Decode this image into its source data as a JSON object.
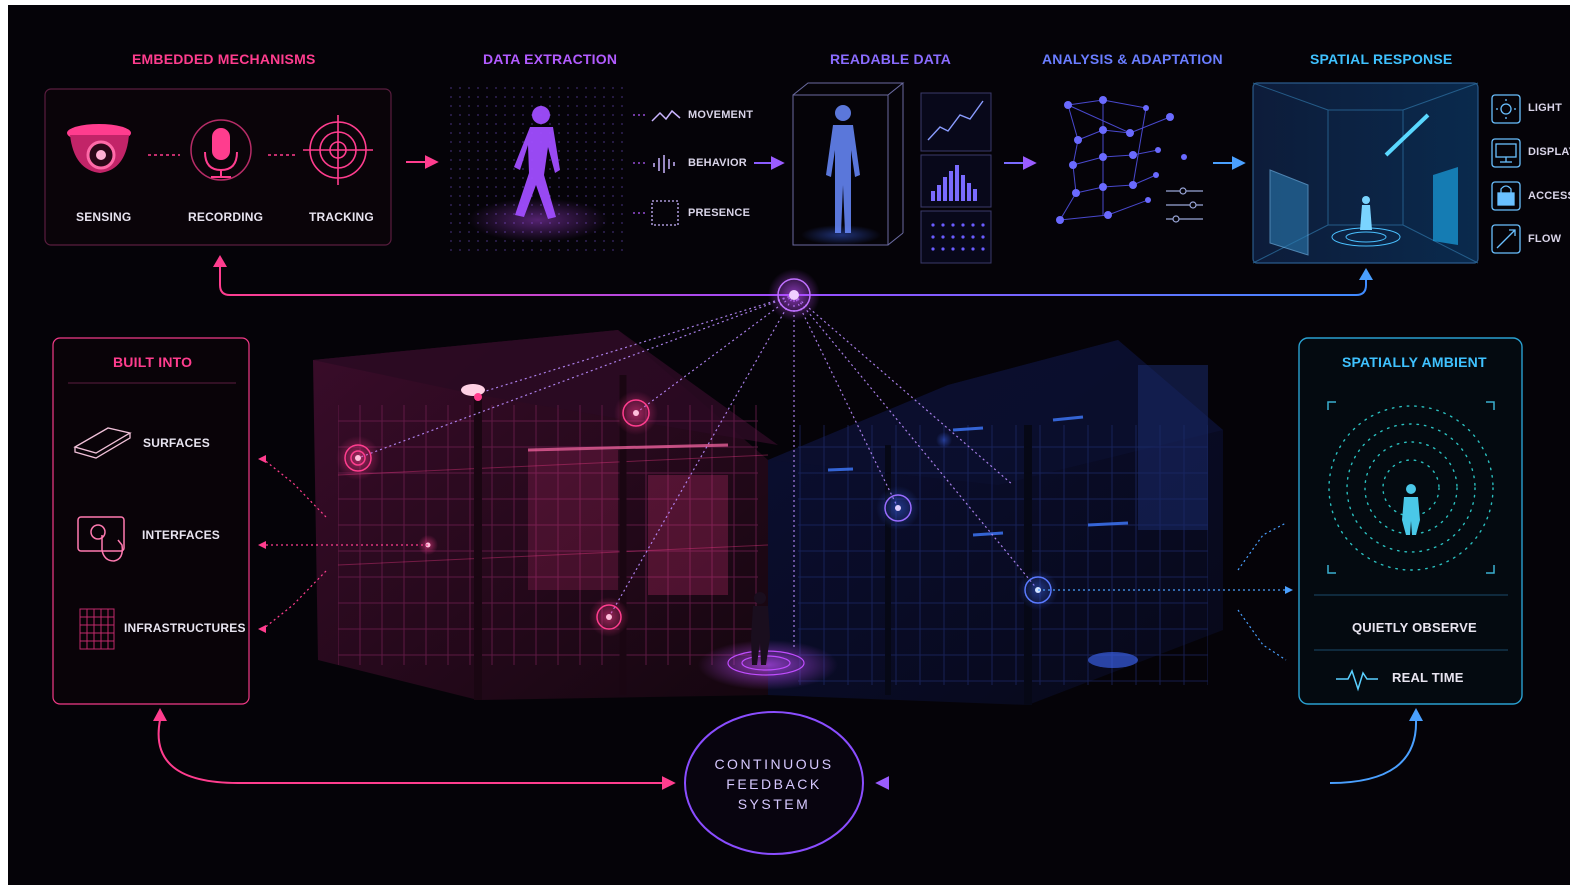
{
  "colors": {
    "background": "#050308",
    "pink": "#ff3d8e",
    "violet": "#b25bff",
    "blue": "#6a7dff",
    "cyan": "#3fc2ff"
  },
  "stages": {
    "embedded": {
      "title": "EMBEDDED MECHANISMS",
      "items": [
        "SENSING",
        "RECORDING",
        "TRACKING"
      ]
    },
    "extraction": {
      "title": "DATA EXTRACTION",
      "outputs": [
        "MOVEMENT",
        "BEHAVIOR",
        "PRESENCE"
      ]
    },
    "readable": {
      "title": "READABLE DATA"
    },
    "analysis": {
      "title": "ANALYSIS & ADAPTATION"
    },
    "response": {
      "title": "SPATIAL RESPONSE",
      "outputs": [
        "LIGHT",
        "DISPLAY",
        "ACCESS",
        "FLOW"
      ]
    }
  },
  "built_into": {
    "title": "BUILT INTO",
    "items": [
      "SURFACES",
      "INTERFACES",
      "INFRASTRUCTURES"
    ]
  },
  "ambient": {
    "title": "SPATIALLY AMBIENT",
    "observe": "QUIETLY OBSERVE",
    "realtime": "REAL TIME"
  },
  "feedback": {
    "line1": "CONTINUOUS",
    "line2": "FEEDBACK",
    "line3": "SYSTEM"
  },
  "icons": [
    "camera-icon",
    "microphone-icon",
    "target-icon",
    "wave-icon",
    "bars-icon",
    "square-icon",
    "sun-icon",
    "monitor-icon",
    "lock-icon",
    "flow-icon",
    "slab-icon",
    "touch-icon",
    "grid-icon",
    "pulse-icon"
  ]
}
